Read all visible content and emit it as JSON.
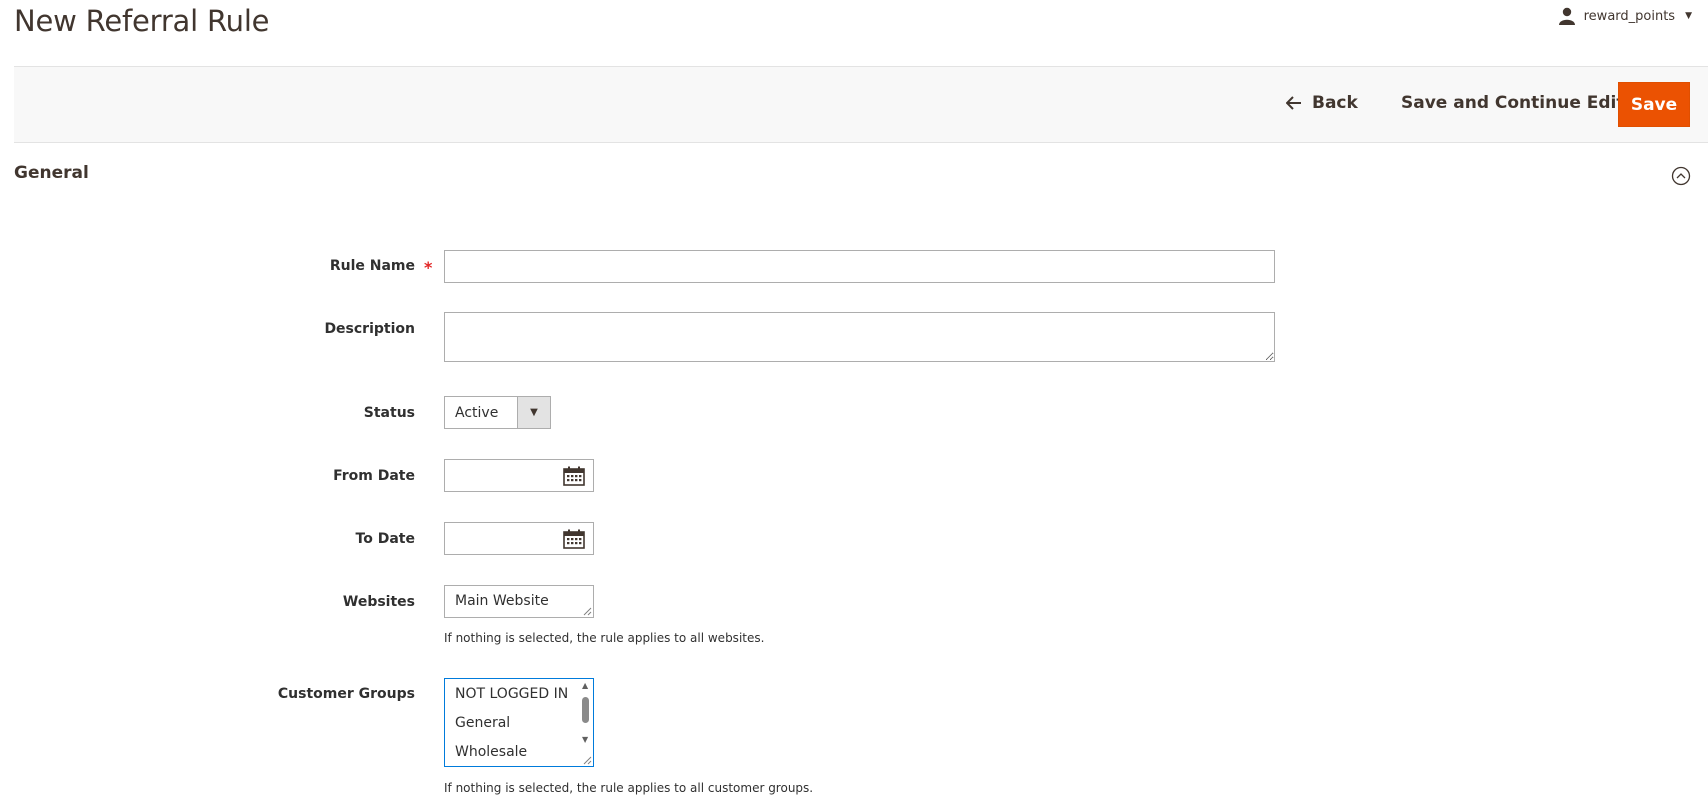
{
  "header": {
    "title": "New Referral Rule",
    "user": "reward_points"
  },
  "actions": {
    "back": "Back",
    "save_continue": "Save and Continue Edit",
    "save": "Save"
  },
  "section": {
    "title": "General"
  },
  "form": {
    "rule_name": {
      "label": "Rule Name",
      "required_mark": "*",
      "value": ""
    },
    "description": {
      "label": "Description",
      "value": ""
    },
    "status": {
      "label": "Status",
      "value": "Active"
    },
    "from_date": {
      "label": "From Date",
      "value": ""
    },
    "to_date": {
      "label": "To Date",
      "value": ""
    },
    "websites": {
      "label": "Websites",
      "options": [
        "Main Website"
      ],
      "note": "If nothing is selected, the rule applies to all websites."
    },
    "customer_groups": {
      "label": "Customer Groups",
      "options": [
        "NOT LOGGED IN",
        "General",
        "Wholesale"
      ],
      "note": "If nothing is selected, the rule applies to all customer groups."
    }
  },
  "colors": {
    "primary_button": "#eb5202",
    "focus_border": "#007bdb",
    "required": "#e22626"
  }
}
